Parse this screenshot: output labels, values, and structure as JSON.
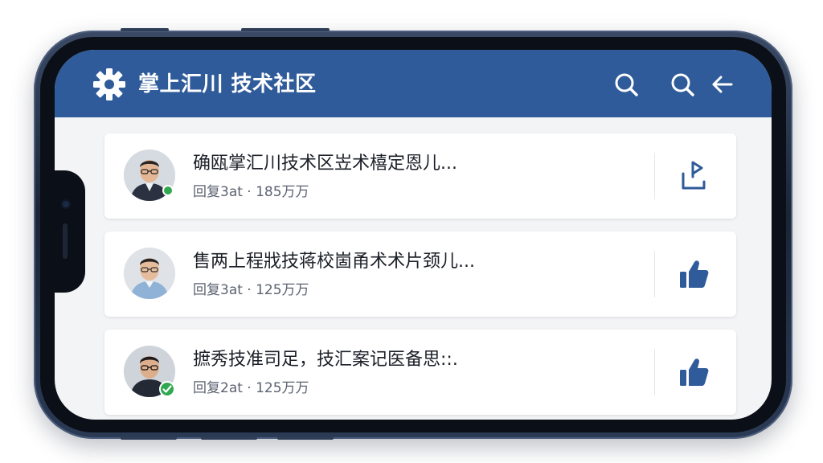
{
  "header": {
    "title": "掌上汇川 技术社区",
    "icons": [
      "gear-icon",
      "search-icon",
      "search-icon",
      "back-arrow-icon"
    ]
  },
  "colors": {
    "header_bg": "#2f5b9a",
    "accent_blue": "#2f5b9a",
    "verified_green": "#2fa84f"
  },
  "posts": [
    {
      "title": "确瓯掌汇川技术区岦术橲定恩儿...",
      "meta": "回复3at · 185万万",
      "action_icon": "share-icon",
      "verified": true
    },
    {
      "title": "售两上程戕技蒋校崮甬术术片颈儿...",
      "meta": "回复3at · 125万万",
      "action_icon": "thumbs-up-icon",
      "verified": false
    },
    {
      "title": "摭秀技准司足，技汇案记医备思::.",
      "meta": "回复2at · 125万万",
      "action_icon": "thumbs-up-icon",
      "verified": true
    }
  ]
}
